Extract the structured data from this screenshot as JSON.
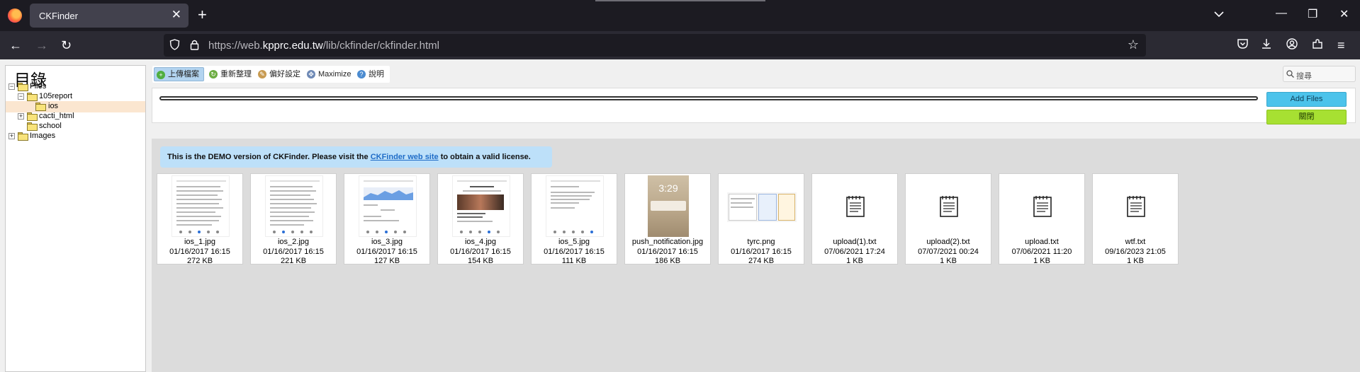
{
  "browser": {
    "tab_title": "CKFinder",
    "url_prefix": "https://web.",
    "url_domain": "kpprc.edu.tw",
    "url_path": "/lib/ckfinder/ckfinder.html"
  },
  "sidebar": {
    "title": "目錄",
    "tree": [
      {
        "label": "Files",
        "toggle": "−"
      },
      {
        "label": "105report",
        "toggle": "−"
      },
      {
        "label": "ios",
        "toggle": ""
      },
      {
        "label": "cacti_html",
        "toggle": "+"
      },
      {
        "label": "school",
        "toggle": ""
      },
      {
        "label": "Images",
        "toggle": "+"
      }
    ]
  },
  "toolbar": {
    "upload": "上傳檔案",
    "refresh": "重新整理",
    "settings": "偏好設定",
    "maximize": "Maximize",
    "help": "說明"
  },
  "search": {
    "placeholder": "搜尋"
  },
  "upload_panel": {
    "add_files": "Add Files",
    "close": "關閉"
  },
  "demo_notice": {
    "before": "This is the DEMO version of CKFinder. Please visit the ",
    "link": "CKFinder web site",
    "after": " to obtain a valid license."
  },
  "files": [
    {
      "name": "ios_1.jpg",
      "date": "01/16/2017 16:15",
      "size": "272 KB"
    },
    {
      "name": "ios_2.jpg",
      "date": "01/16/2017 16:15",
      "size": "221 KB"
    },
    {
      "name": "ios_3.jpg",
      "date": "01/16/2017 16:15",
      "size": "127 KB"
    },
    {
      "name": "ios_4.jpg",
      "date": "01/16/2017 16:15",
      "size": "154 KB"
    },
    {
      "name": "ios_5.jpg",
      "date": "01/16/2017 16:15",
      "size": "111 KB"
    },
    {
      "name": "push_notification.jpg",
      "date": "01/16/2017 16:15",
      "size": "186 KB"
    },
    {
      "name": "tyrc.png",
      "date": "01/16/2017 16:15",
      "size": "274 KB"
    },
    {
      "name": "upload(1).txt",
      "date": "07/06/2021 17:24",
      "size": "1 KB"
    },
    {
      "name": "upload(2).txt",
      "date": "07/07/2021 00:24",
      "size": "1 KB"
    },
    {
      "name": "upload.txt",
      "date": "07/06/2021 11:20",
      "size": "1 KB"
    },
    {
      "name": "wtf.txt",
      "date": "09/16/2023 21:05",
      "size": "1 KB"
    }
  ],
  "thumb_texts": {
    "push_time": "3:29"
  },
  "colors": {
    "add_files": "#4cc3eb",
    "close": "#a7e032",
    "selected_row": "#fbe6d0",
    "demo_notice": "#bde0f9"
  }
}
